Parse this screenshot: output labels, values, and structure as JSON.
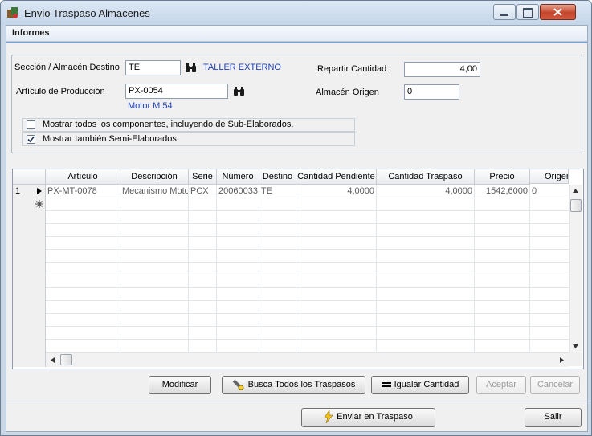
{
  "window": {
    "title": "Envio Traspaso Almacenes"
  },
  "menu": {
    "informes": "Informes"
  },
  "form": {
    "seccion_label": "Sección / Almacén Destino",
    "seccion_value": "TE",
    "seccion_desc": "TALLER EXTERNO",
    "articulo_label": "Artículo de Producción",
    "articulo_value": "PX-0054",
    "articulo_desc": "Motor M.54",
    "repartir_label": "Repartir Cantidad :",
    "repartir_value": "4,00",
    "almacen_origen_label": "Almacén Origen",
    "almacen_origen_value": "0",
    "chk_componentes_label": "Mostrar todos los componentes, incluyendo de Sub-Elaborados.",
    "chk_componentes_checked": false,
    "chk_semi_label": "Mostrar también Semi-Elaborados",
    "chk_semi_checked": true
  },
  "grid": {
    "columns": [
      "Artículo",
      "Descripción",
      "Serie",
      "Número",
      "Destino",
      "Cantidad Pendiente",
      "Cantidad Traspaso",
      "Precio",
      "Origen"
    ],
    "rows": [
      {
        "index": "1",
        "articulo": "PX-MT-0078",
        "descripcion": "Mecanismo Motor",
        "serie": "PCX",
        "numero": "20060033",
        "destino": "TE",
        "cantidad_pendiente": "4,0000",
        "cantidad_traspaso": "4,0000",
        "precio": "1542,6000",
        "origen": "0"
      }
    ]
  },
  "buttons": {
    "modificar": "Modificar",
    "busca": "Busca Todos los Traspasos",
    "igualar": "Igualar Cantidad",
    "aceptar": "Aceptar",
    "cancelar": "Cancelar",
    "enviar": "Enviar en Traspaso",
    "salir": "Salir"
  },
  "colors": {
    "link_blue": "#1e3fb8",
    "close_red": "#c4452b"
  }
}
